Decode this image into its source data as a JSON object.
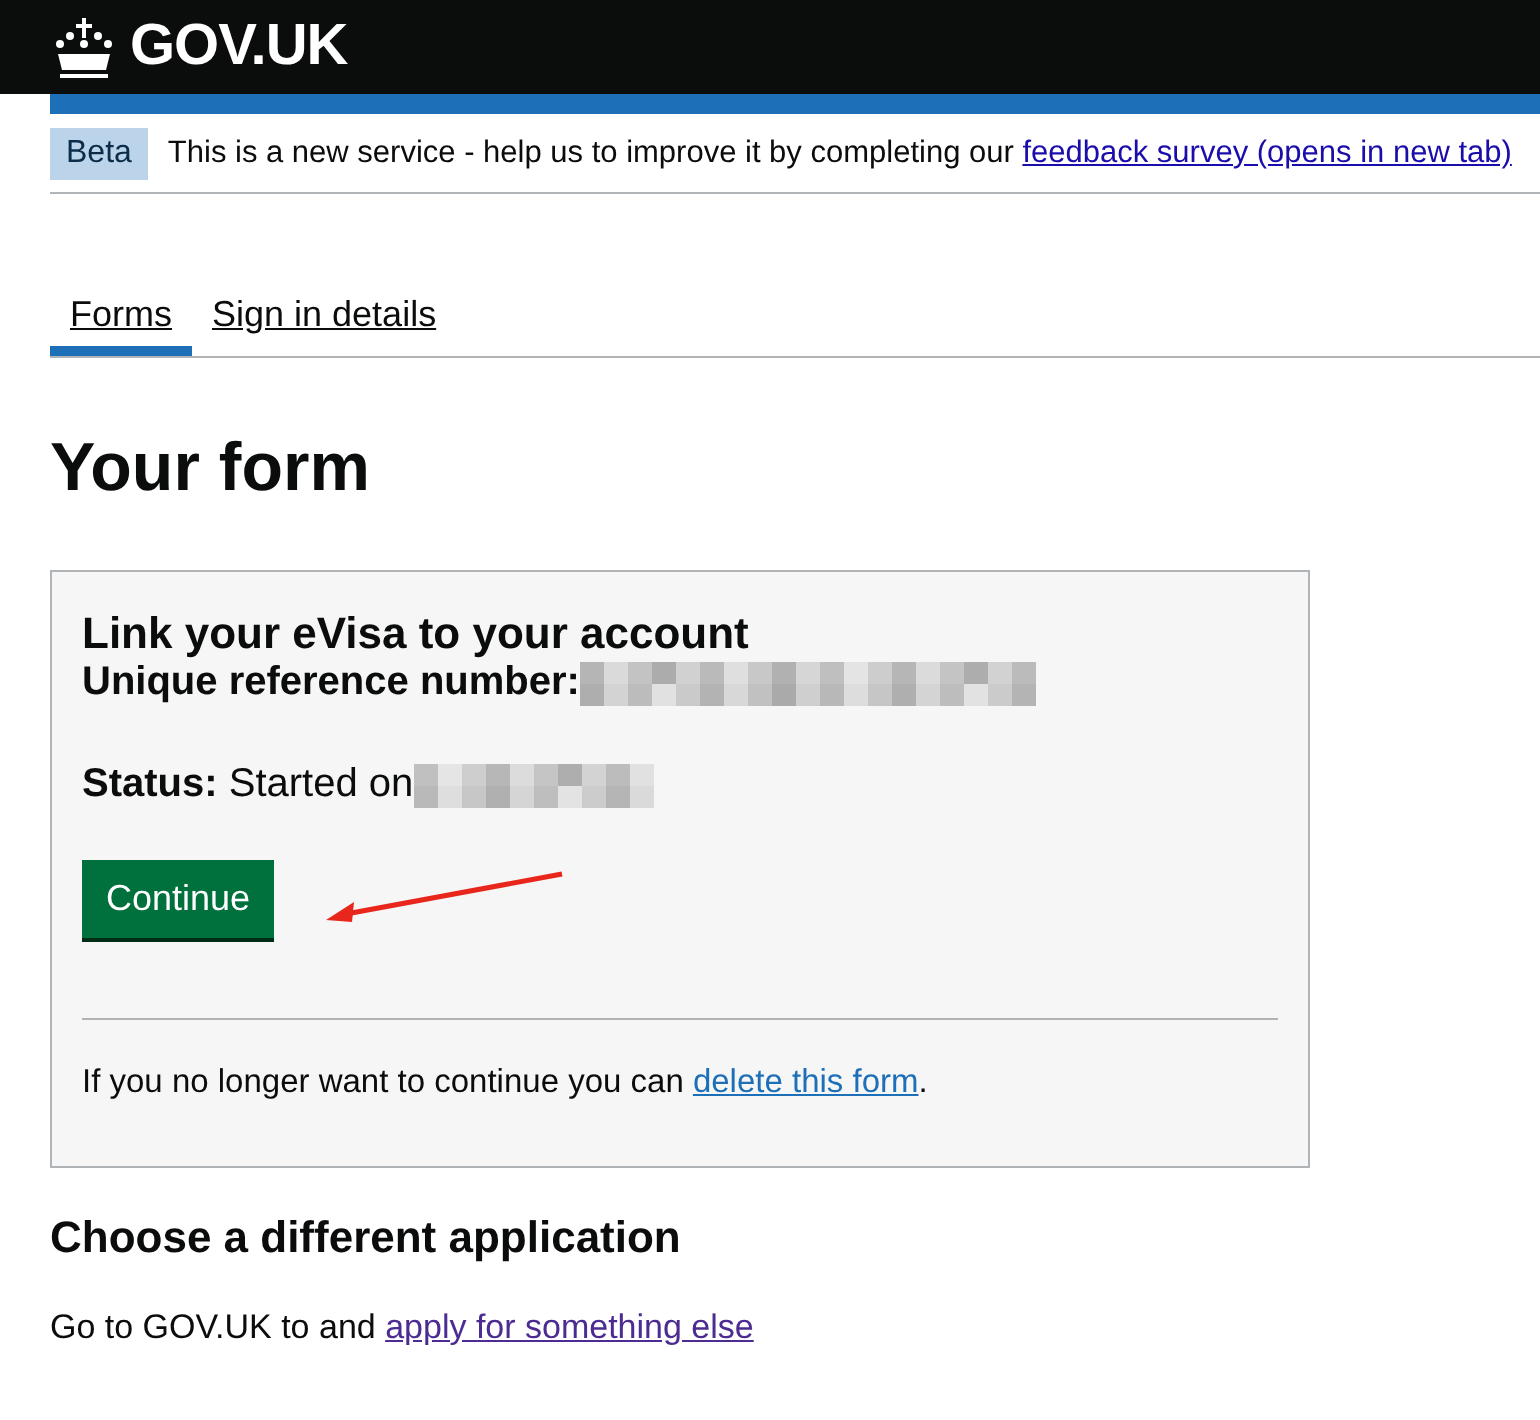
{
  "header": {
    "logo": "GOV.UK"
  },
  "phase_banner": {
    "tag": "Beta",
    "text": "This is a new service - help us to improve it by completing our ",
    "link": "feedback survey (opens in new tab)"
  },
  "tabs": [
    {
      "label": "Forms",
      "selected": true
    },
    {
      "label": "Sign in details",
      "selected": false
    }
  ],
  "heading": "Your form",
  "form_card": {
    "title": "Link your eVisa to your account",
    "reference_label": "Unique reference number:",
    "status": "**Status:** Started on",
    "button": "Continue",
    "delete_text": "If you no longer want to continue you can ",
    "delete_link": "delete this form",
    "delete_end": "."
  },
  "other": {
    "heading": "Choose a different application",
    "text": "Go to GOV.UK to and ",
    "link": "apply for something else"
  }
}
